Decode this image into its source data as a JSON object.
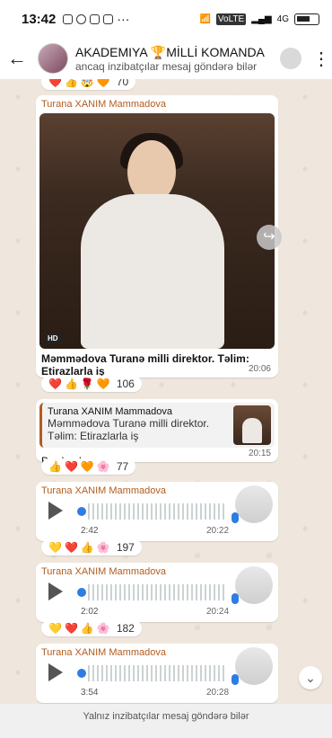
{
  "status_bar": {
    "time": "13:42",
    "more": "···",
    "network_labels": [
      "VoLTE",
      "4G"
    ]
  },
  "header": {
    "back_icon": "arrow-left-icon",
    "title": "AKADEMIYA 🏆MİLLİ KOMANDA",
    "subtitle": "ancaq inzibatçılar mesaj göndərə bilər"
  },
  "messages": [
    {
      "type": "reactions",
      "emojis": [
        "❤️",
        "👍",
        "🤯",
        "🧡"
      ],
      "count": "70"
    },
    {
      "type": "image",
      "sender": "Turana XANIM Mammadova",
      "hd_badge": "HD",
      "caption": "Məmmədova Turanə milli direktor. Təlim: Etirazlarla iş",
      "time": "20:06",
      "reactions": {
        "emojis": [
          "❤️",
          "👍",
          "🌹",
          "🧡"
        ],
        "count": "106"
      }
    },
    {
      "type": "reply",
      "quote_sender": "Turana XANIM Mammadova",
      "quote_text_1": "Məmmədova Turanə milli direktor.",
      "quote_text_2": "Təlim: Etirazlarla iş",
      "text": "Burda olacaq",
      "time": "20:15",
      "reactions": {
        "emojis": [
          "👍",
          "❤️",
          "🧡",
          "🌸"
        ],
        "count": "77"
      }
    },
    {
      "type": "voice",
      "sender": "Turana XANIM Mammadova",
      "duration": "2:42",
      "time": "20:22",
      "reactions": {
        "emojis": [
          "💛",
          "❤️",
          "👍",
          "🌸"
        ],
        "count": "197"
      }
    },
    {
      "type": "voice",
      "sender": "Turana XANIM Mammadova",
      "duration": "2:02",
      "time": "20:24",
      "reactions": {
        "emojis": [
          "💛",
          "❤️",
          "👍",
          "🌸"
        ],
        "count": "182"
      }
    },
    {
      "type": "voice",
      "sender": "Turana XANIM Mammadova",
      "duration": "3:54",
      "time": "20:28"
    }
  ],
  "footer": {
    "notice": "Yalnız inzibatçılar mesaj göndərə bilər"
  }
}
